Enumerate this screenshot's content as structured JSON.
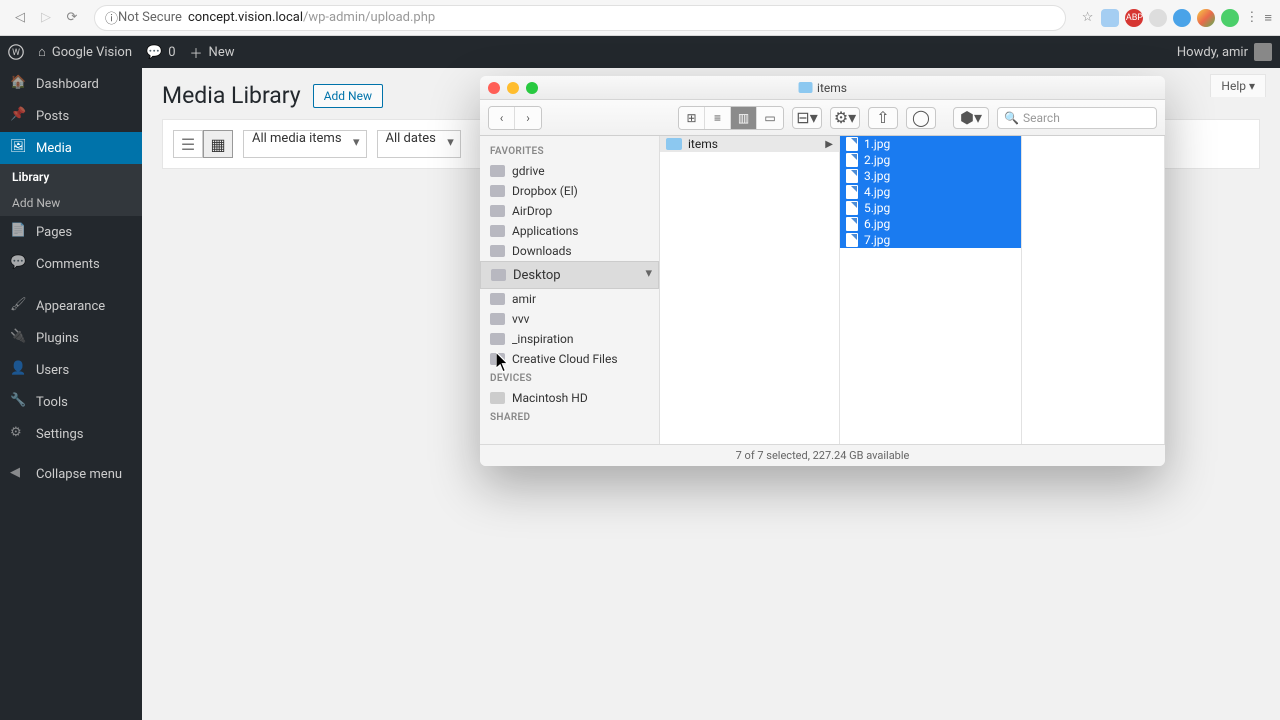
{
  "browser": {
    "not_secure": "Not Secure",
    "url_host": "concept.vision.local",
    "url_path": "/wp-admin/upload.php"
  },
  "adminbar": {
    "site_name": "Google Vision",
    "comments": "0",
    "new": "New",
    "howdy": "Howdy, amir"
  },
  "sidebar": {
    "dashboard": "Dashboard",
    "posts": "Posts",
    "media": "Media",
    "media_sub": {
      "library": "Library",
      "addnew": "Add New"
    },
    "pages": "Pages",
    "comments": "Comments",
    "appearance": "Appearance",
    "plugins": "Plugins",
    "users": "Users",
    "tools": "Tools",
    "settings": "Settings",
    "collapse": "Collapse menu"
  },
  "page": {
    "title": "Media Library",
    "add_new": "Add New",
    "help": "Help ▾",
    "filter_type": "All media items",
    "filter_date": "All dates"
  },
  "finder": {
    "title": "items",
    "search_placeholder": "Search",
    "sections": {
      "favorites": "Favorites",
      "devices": "Devices",
      "shared": "Shared"
    },
    "favorites": [
      "gdrive",
      "Dropbox (El)",
      "AirDrop",
      "Applications",
      "Downloads",
      "Desktop",
      "amir",
      "vvv",
      "_inspiration",
      "Creative Cloud Files"
    ],
    "favorites_selected": "Desktop",
    "devices": [
      "Macintosh HD"
    ],
    "col1": {
      "folder": "items"
    },
    "files": [
      "1.jpg",
      "2.jpg",
      "3.jpg",
      "4.jpg",
      "5.jpg",
      "6.jpg",
      "7.jpg"
    ],
    "status": "7 of 7 selected, 227.24 GB available"
  }
}
